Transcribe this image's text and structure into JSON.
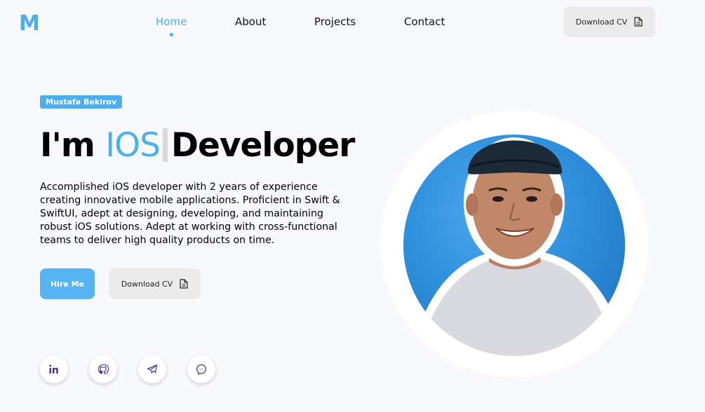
{
  "brand": {
    "logo_text": "M",
    "accent": "#4aaef0"
  },
  "nav": {
    "items": [
      {
        "label": "Home",
        "active": true
      },
      {
        "label": "About",
        "active": false
      },
      {
        "label": "Projects",
        "active": false
      },
      {
        "label": "Contact",
        "active": false
      }
    ],
    "download_cv": {
      "label": "Download CV",
      "icon": "document-icon"
    }
  },
  "hero": {
    "badge": "Mustafa Bekirov",
    "headline_prefix": "I'm",
    "headline_accent": "IOS",
    "headline_suffix": "Developer",
    "bio": "Accomplished iOS developer with 2 years of experience creating innovative mobile applications. Proficient in Swift & SwiftUI, adept at designing, developing, and maintaining robust iOS solutions. Adept at working with cross-functional teams to deliver high quality products on time.",
    "hire_label": "Hire Me",
    "download_label": "Download CV"
  },
  "socials": [
    {
      "name": "linkedin-icon"
    },
    {
      "name": "github-icon"
    },
    {
      "name": "telegram-icon"
    },
    {
      "name": "messenger-icon"
    }
  ],
  "profile_photo": {
    "name": "profile-photo",
    "background": "#2f8fdb"
  }
}
